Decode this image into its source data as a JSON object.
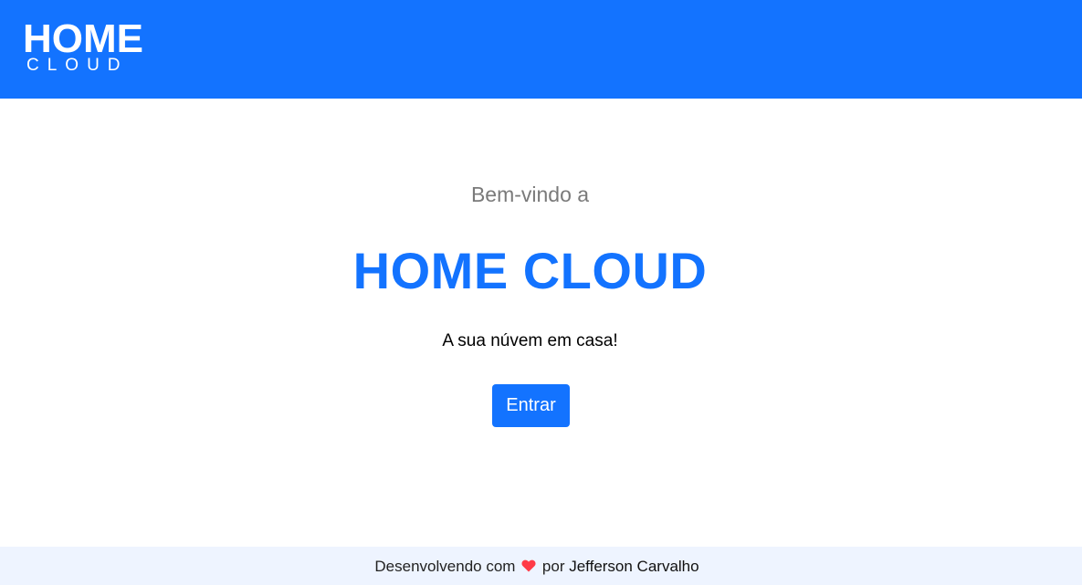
{
  "header": {
    "logo_top": "HOME",
    "logo_bottom": "CLOUD"
  },
  "hero": {
    "welcome": "Bem-vindo a",
    "title": "HOME CLOUD",
    "tagline": "A sua núvem em casa!",
    "enter_label": "Entrar"
  },
  "footer": {
    "prefix": "Desenvolvendo com",
    "middle": "por",
    "author": "Jefferson Carvalho",
    "heart_icon": "heart-icon"
  },
  "colors": {
    "brand": "#1373ff",
    "heart": "#ff3b47",
    "footer_bg": "#eef4ff"
  }
}
